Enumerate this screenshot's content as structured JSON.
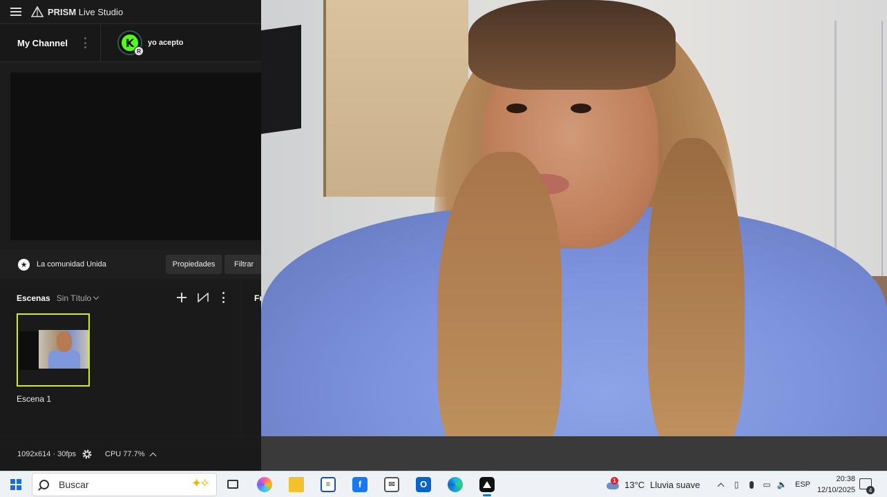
{
  "app": {
    "title_brand": "PRISM",
    "title_rest": "Live Studio",
    "channel_label": "My Channel",
    "channel_name": "yo acepto",
    "avatar_letter": "K",
    "avatar_badge": "R"
  },
  "source_bar": {
    "source_name": "La comunidad Unida",
    "properties_label": "Propiedades",
    "filter_label": "Filtrar"
  },
  "scenes": {
    "title": "Escenas",
    "collection": "Sin Título",
    "items": [
      {
        "label": "Escena 1",
        "selected": true
      }
    ],
    "right_panel_title": "Fu"
  },
  "status": {
    "resolution": "1092x614 · 30fps",
    "cpu": "CPU 77.7%"
  },
  "taskbar": {
    "search_placeholder": "Buscar",
    "apps": [
      "task-view",
      "copilot",
      "file-explorer",
      "notepad",
      "facebook",
      "mail",
      "outlook",
      "edge",
      "prism-live-studio"
    ],
    "active_app": "prism-live-studio",
    "weather": {
      "alert_count": "1",
      "temperature": "13°C",
      "condition": "Lluvia suave"
    },
    "language": "ESP",
    "time": "20:38",
    "date": "12/10/2025",
    "notification_count": "4"
  },
  "colors": {
    "accent_selected": "#d4f01a",
    "kick_green": "#53fc18",
    "taskbar_bg": "#eef1f6"
  }
}
